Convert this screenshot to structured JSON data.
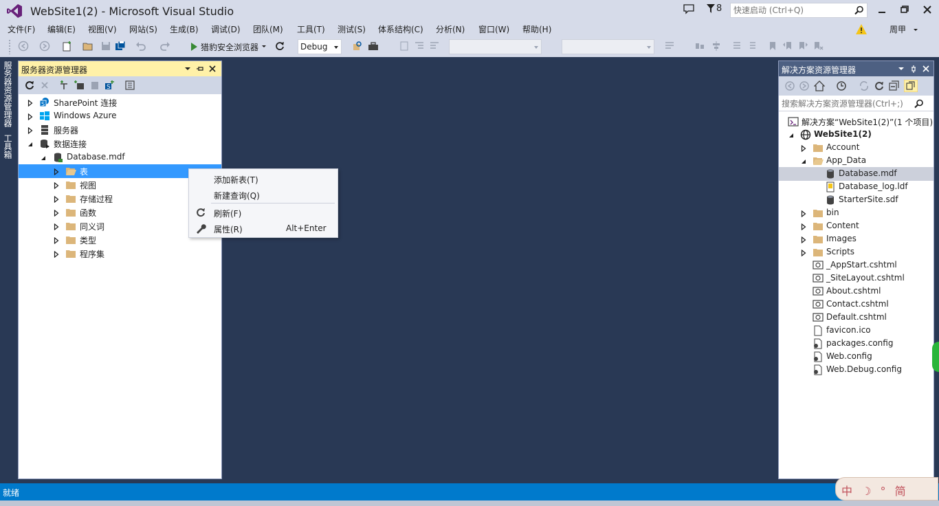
{
  "window": {
    "title": "WebSite1(2) - Microsoft Visual Studio",
    "filter_count": "8",
    "quick_launch_placeholder": "快速启动 (Ctrl+Q)",
    "user_name": "周甲"
  },
  "menu": [
    "文件(F)",
    "编辑(E)",
    "视图(V)",
    "网站(S)",
    "生成(B)",
    "调试(D)",
    "团队(M)",
    "工具(T)",
    "测试(S)",
    "体系结构(C)",
    "分析(N)",
    "窗口(W)",
    "帮助(H)"
  ],
  "toolbar": {
    "run_label": "猎豹安全浏览器",
    "config": "Debug"
  },
  "left_tabs": [
    "服务器资源管理器",
    "工具箱"
  ],
  "server_explorer": {
    "title": "服务器资源管理器",
    "tree": [
      {
        "label": "SharePoint 连接",
        "icon": "sharepoint-icon"
      },
      {
        "label": "Windows Azure",
        "icon": "windows-icon"
      },
      {
        "label": "服务器",
        "icon": "server-icon"
      },
      {
        "label": "数据连接",
        "icon": "data-connection-icon"
      },
      {
        "label": "Database.mdf",
        "icon": "database-icon"
      },
      {
        "label": "表",
        "icon": "folder-icon"
      },
      {
        "label": "视图",
        "icon": "folder-icon"
      },
      {
        "label": "存储过程",
        "icon": "folder-icon"
      },
      {
        "label": "函数",
        "icon": "folder-icon"
      },
      {
        "label": "同义词",
        "icon": "folder-icon"
      },
      {
        "label": "类型",
        "icon": "folder-icon"
      },
      {
        "label": "程序集",
        "icon": "folder-icon"
      }
    ]
  },
  "context_menu": {
    "items": [
      {
        "label": "添加新表(T)"
      },
      {
        "label": "新建查询(Q)"
      },
      {
        "label": "刷新(F)",
        "icon": "refresh-icon"
      },
      {
        "label": "属性(R)",
        "shortcut": "Alt+Enter",
        "icon": "wrench-icon"
      }
    ]
  },
  "solution_explorer": {
    "title": "解决方案资源管理器",
    "search_placeholder": "搜索解决方案资源管理器(Ctrl+;)",
    "tree": [
      {
        "label": "解决方案“WebSite1(2)”(1 个项目)"
      },
      {
        "label": "WebSite1(2)"
      },
      {
        "label": "Account"
      },
      {
        "label": "App_Data"
      },
      {
        "label": "Database.mdf"
      },
      {
        "label": "Database_log.ldf"
      },
      {
        "label": "StarterSite.sdf"
      },
      {
        "label": "bin"
      },
      {
        "label": "Content"
      },
      {
        "label": "Images"
      },
      {
        "label": "Scripts"
      },
      {
        "label": "_AppStart.cshtml"
      },
      {
        "label": "_SiteLayout.cshtml"
      },
      {
        "label": "About.cshtml"
      },
      {
        "label": "Contact.cshtml"
      },
      {
        "label": "Default.cshtml"
      },
      {
        "label": "favicon.ico"
      },
      {
        "label": "packages.config"
      },
      {
        "label": "Web.config"
      },
      {
        "label": "Web.Debug.config"
      }
    ]
  },
  "status": {
    "text": "就绪"
  },
  "ime": {
    "text": "中 ☽ ° 简"
  }
}
